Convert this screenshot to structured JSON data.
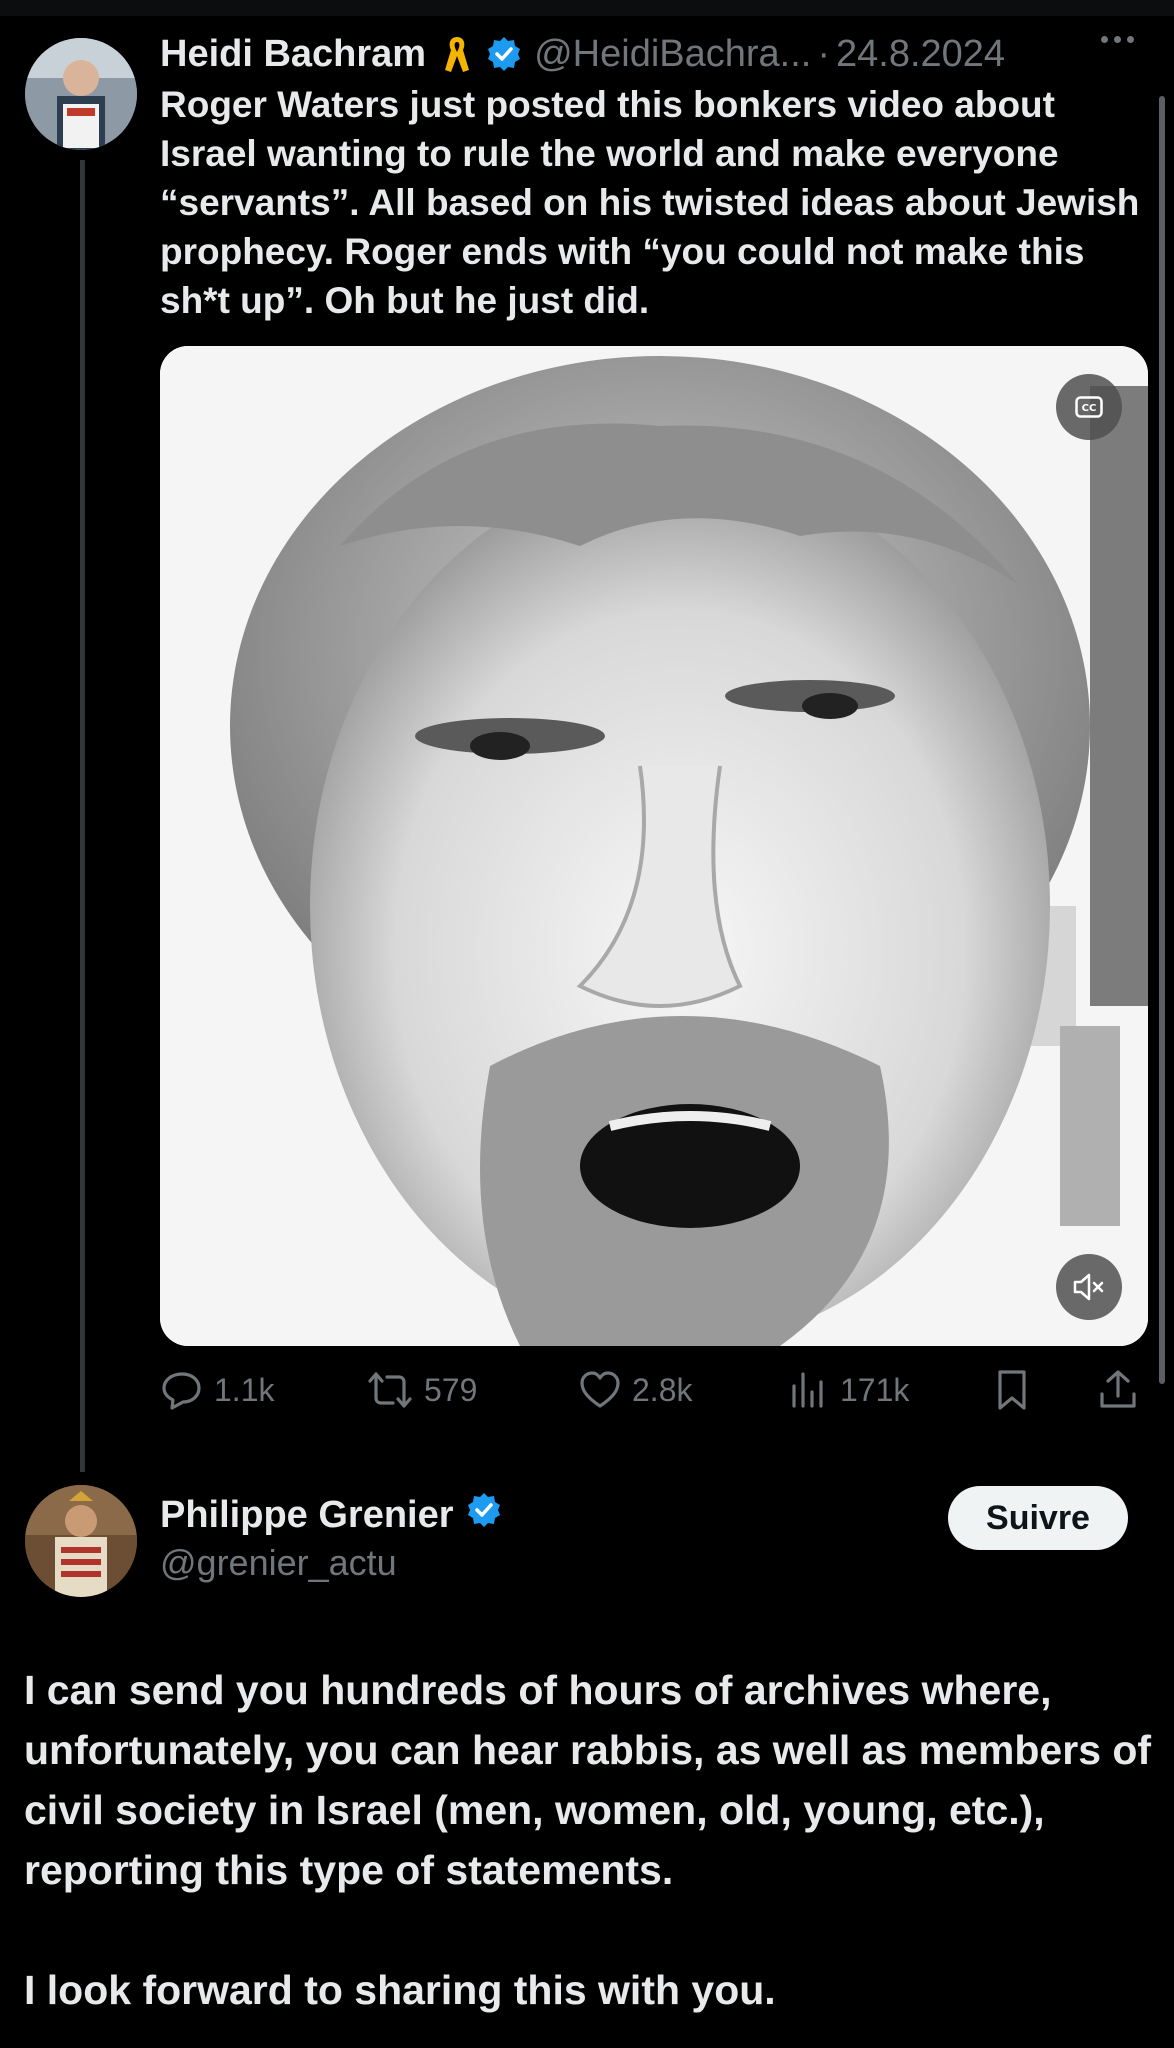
{
  "tweet": {
    "author_name": "Heidi Bachram",
    "handle": "@HeidiBachra...",
    "separator": "·",
    "date": "24.8.2024",
    "text": "Roger Waters just posted this bonkers video about Israel wanting to rule the world and make everyone “servants”. All based on his twisted ideas about Jewish prophecy. Roger ends with “you could not make this sh*t up”. Oh but he just did.",
    "media": {
      "cc_icon": "closed-captions-icon",
      "mute_icon": "speaker-muted-icon"
    },
    "stats": {
      "replies": "1.1k",
      "reposts": "579",
      "likes": "2.8k",
      "views": "171k"
    }
  },
  "reply": {
    "author_name": "Philippe Grenier",
    "handle": "@grenier_actu",
    "follow_label": "Suivre",
    "paragraph1": "I can send you hundreds of hours of archives where, unfortunately, you can hear rabbis, as well as members of civil society in Israel (men, women, old, young, etc.), reporting this type of statements.",
    "paragraph2": "I look forward to sharing this with you."
  },
  "colors": {
    "background": "#000000",
    "text": "#e7e9ea",
    "muted": "#71767b",
    "verified": "#1d9bf0",
    "ribbon": "#f4b400"
  }
}
